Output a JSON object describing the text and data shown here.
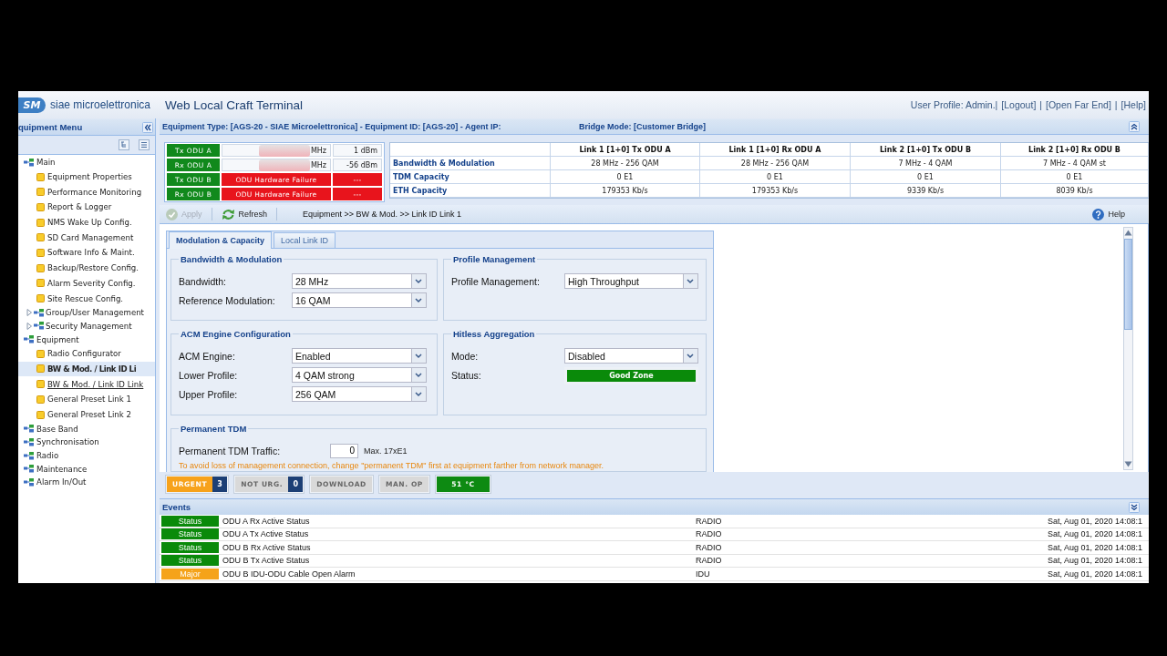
{
  "header": {
    "logo_mark": "SM",
    "brand": "siae microelettronica",
    "title": "Web Local Craft Terminal",
    "user_profile": "User Profile: Admin.|",
    "links": [
      "[Logout]",
      "[Open Far End]",
      "[Help]"
    ],
    "link_separators": [
      "|",
      "|"
    ]
  },
  "sidebar": {
    "title": "quipment Menu",
    "tree": [
      {
        "label": "Main",
        "kind": "folder",
        "selected": false,
        "hovered": false,
        "children": [
          {
            "label": "Equipment Properties",
            "kind": "leaf",
            "selected": false,
            "hovered": false
          },
          {
            "label": "Performance Monitoring",
            "kind": "leaf",
            "selected": false,
            "hovered": false
          },
          {
            "label": "Report & Logger",
            "kind": "leaf",
            "selected": false,
            "hovered": false
          },
          {
            "label": "NMS Wake Up Config.",
            "kind": "leaf",
            "selected": false,
            "hovered": false
          },
          {
            "label": "SD Card Management",
            "kind": "leaf",
            "selected": false,
            "hovered": false
          },
          {
            "label": "Software Info & Maint.",
            "kind": "leaf",
            "selected": false,
            "hovered": false
          },
          {
            "label": "Backup/Restore Config.",
            "kind": "leaf",
            "selected": false,
            "hovered": false
          },
          {
            "label": "Alarm Severity Config.",
            "kind": "leaf",
            "selected": false,
            "hovered": false
          },
          {
            "label": "Site Rescue Config.",
            "kind": "leaf",
            "selected": false,
            "hovered": false
          },
          {
            "label": "Group/User Management",
            "kind": "folder",
            "expanded": false,
            "selected": false,
            "hovered": false
          },
          {
            "label": "Security Management",
            "kind": "folder",
            "expanded": false,
            "selected": false,
            "hovered": false
          }
        ]
      },
      {
        "label": "Equipment",
        "kind": "folder",
        "selected": false,
        "hovered": false,
        "children": [
          {
            "label": "Radio Configurator",
            "kind": "leaf",
            "selected": false,
            "hovered": false
          },
          {
            "label": "BW & Mod. / Link ID Li",
            "kind": "leaf",
            "selected": true,
            "hovered": false
          },
          {
            "label": "BW & Mod. / Link ID Link",
            "kind": "leaf",
            "selected": false,
            "hovered": true
          },
          {
            "label": "General Preset Link 1",
            "kind": "leaf",
            "selected": false,
            "hovered": false
          },
          {
            "label": "General Preset Link 2",
            "kind": "leaf",
            "selected": false,
            "hovered": false
          }
        ]
      },
      {
        "label": "Base Band",
        "kind": "folder",
        "selected": false,
        "hovered": false
      },
      {
        "label": "Synchronisation",
        "kind": "folder",
        "selected": false,
        "hovered": false
      },
      {
        "label": "Radio",
        "kind": "folder",
        "selected": false,
        "hovered": false
      },
      {
        "label": "Maintenance",
        "kind": "folder",
        "selected": false,
        "hovered": false
      },
      {
        "label": "Alarm In/Out",
        "kind": "folder",
        "selected": false,
        "hovered": false
      }
    ]
  },
  "equipment_bar": {
    "info": "Equipment Type: [AGS-20 - SIAE Microelettronica] - Equipment ID: [AGS-20] - Agent IP:",
    "bridge_mode": "Bridge Mode: [Customer Bridge]"
  },
  "odu_status": [
    {
      "label": "Tx ODU A",
      "value": "MHz",
      "power": "1 dBm",
      "alarm": false,
      "blurred": true
    },
    {
      "label": "Rx ODU A",
      "value": "MHz",
      "power": "-56 dBm",
      "alarm": false,
      "blurred": true
    },
    {
      "label": "Tx ODU B",
      "value": "ODU Hardware Failure",
      "power": "---",
      "alarm": true,
      "blurred": false
    },
    {
      "label": "Rx ODU B",
      "value": "ODU Hardware Failure",
      "power": "---",
      "alarm": true,
      "blurred": false
    }
  ],
  "link_summary": {
    "columns": [
      "Link 1 [1+0] Tx ODU A",
      "Link 1 [1+0] Rx ODU A",
      "Link 2 [1+0] Tx ODU B",
      "Link 2 [1+0] Rx ODU B"
    ],
    "rows": [
      {
        "label": "Bandwidth & Modulation",
        "cells": [
          "28 MHz - 256 QAM",
          "28 MHz - 256 QAM",
          "7 MHz - 4 QAM",
          "7 MHz - 4 QAM st"
        ]
      },
      {
        "label": "TDM Capacity",
        "cells": [
          "0 E1",
          "0 E1",
          "0 E1",
          "0 E1"
        ]
      },
      {
        "label": "ETH Capacity",
        "cells": [
          "179353 Kb/s",
          "179353 Kb/s",
          "9339 Kb/s",
          "8039 Kb/s"
        ]
      }
    ]
  },
  "toolbar": {
    "buttons": [
      {
        "kind": "apply",
        "label": "Apply",
        "disabled": true
      },
      {
        "kind": "refresh",
        "label": "Refresh",
        "disabled": false
      }
    ],
    "breadcrumb": "Equipment >> BW & Mod. >> Link ID Link 1",
    "help": "Help"
  },
  "form": {
    "tabs": [
      {
        "label": "Modulation & Capacity",
        "selected": true
      },
      {
        "label": "Local Link ID",
        "selected": false
      }
    ],
    "section_rows": [
      [
        {
          "title": "Bandwidth & Modulation",
          "fields": [
            {
              "kind": "select",
              "label": "Bandwidth:",
              "value": "28 MHz"
            },
            {
              "kind": "select",
              "label": "Reference Modulation:",
              "value": "16 QAM"
            }
          ]
        },
        {
          "title": "Profile Management",
          "fields": [
            {
              "kind": "select",
              "label": "Profile Management:",
              "value": "High Throughput"
            }
          ]
        }
      ],
      [
        {
          "title": "ACM Engine Configuration",
          "fields": [
            {
              "kind": "select",
              "label": "ACM Engine:",
              "value": "Enabled"
            },
            {
              "kind": "select",
              "label": "Lower Profile:",
              "value": "4 QAM strong"
            },
            {
              "kind": "select",
              "label": "Upper Profile:",
              "value": "256 QAM"
            }
          ]
        },
        {
          "title": "Hitless Aggregation",
          "fields": [
            {
              "kind": "select",
              "label": "Mode:",
              "value": "Disabled"
            },
            {
              "kind": "status",
              "label": "Status:",
              "value": "Good Zone"
            }
          ]
        }
      ],
      [
        {
          "title": "Permanent TDM",
          "fields": [
            {
              "kind": "number",
              "label": "Permanent TDM Traffic:",
              "value": "0",
              "hint": "Max. 17xE1"
            }
          ],
          "note": "To avoid loss of management connection, change \"permanent TDM\" first at equipment farther from network manager."
        }
      ]
    ]
  },
  "alarm_bar": [
    {
      "kind": "counter",
      "label": "URGENT",
      "count": "3",
      "active": true
    },
    {
      "kind": "counter",
      "label": "NOT URG.",
      "count": "0",
      "active": false
    },
    {
      "kind": "indicator",
      "label": "DOWNLOAD",
      "active": false
    },
    {
      "kind": "indicator",
      "label": "MAN. OP",
      "active": false
    },
    {
      "kind": "temperature",
      "label": "51 °C"
    }
  ],
  "events": {
    "title": "Events",
    "rows": [
      {
        "severity": "Status",
        "color": "#0a8a0a",
        "description": "ODU A Rx Active Status",
        "source": "RADIO",
        "time": "Sat, Aug 01, 2020 14:08:1"
      },
      {
        "severity": "Status",
        "color": "#0a8a0a",
        "description": "ODU A Tx Active Status",
        "source": "RADIO",
        "time": "Sat, Aug 01, 2020 14:08:1"
      },
      {
        "severity": "Status",
        "color": "#0a8a0a",
        "description": "ODU B Rx Active Status",
        "source": "RADIO",
        "time": "Sat, Aug 01, 2020 14:08:1"
      },
      {
        "severity": "Status",
        "color": "#0a8a0a",
        "description": "ODU B Tx Active Status",
        "source": "RADIO",
        "time": "Sat, Aug 01, 2020 14:08:1"
      },
      {
        "severity": "Major",
        "color": "#f5a31a",
        "description": "ODU B IDU-ODU Cable Open Alarm",
        "source": "IDU",
        "time": "Sat, Aug 01, 2020 14:08:1"
      }
    ]
  }
}
